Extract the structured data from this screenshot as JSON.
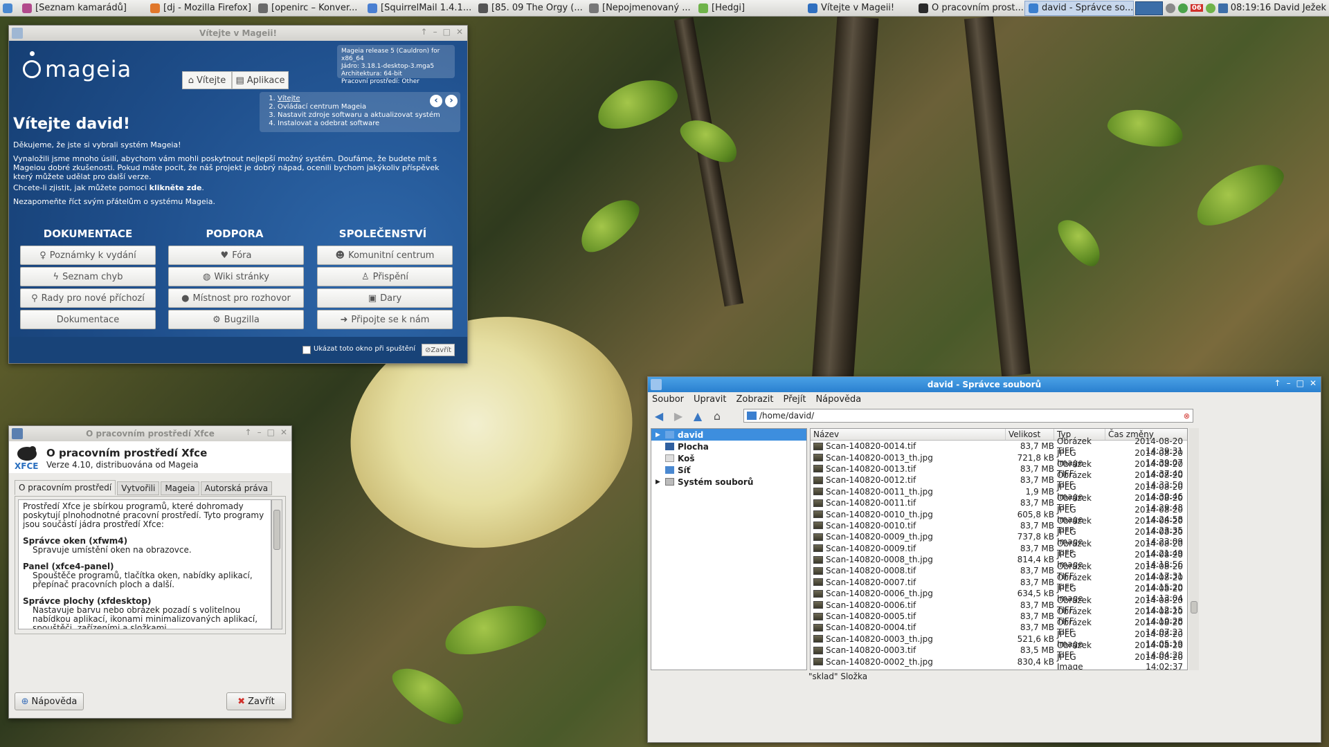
{
  "taskbar": {
    "tasks": [
      {
        "label": "[Seznam kamarádů]",
        "color": "#b24a8c"
      },
      {
        "label": "[dj - Mozilla Firefox]",
        "color": "#e0772a"
      },
      {
        "label": "[openirc – Konver...",
        "color": "#6a6a6a"
      },
      {
        "label": "[SquirrelMail 1.4.1...",
        "color": "#4a7fd1"
      },
      {
        "label": "[85. 09 The Orgy (...",
        "color": "#555555"
      },
      {
        "label": "[Nepojmenovaný ...",
        "color": "#777777"
      },
      {
        "label": "[Hedgi]",
        "color": "#6fb34a"
      },
      {
        "label": "Vítejte v Mageii!",
        "color": "#2f6fbf"
      },
      {
        "label": "O pracovním prost...",
        "color": "#2a2a2a"
      },
      {
        "label": "david - Správce so...",
        "color": "#3b7fcf"
      }
    ],
    "clock": "08:19:16",
    "user": "David Ježek",
    "badge": "06"
  },
  "mageia": {
    "title": "Vítejte v Mageii!",
    "logo": "mageia",
    "release": [
      "Mageia release 5 (Cauldron) for x86_64",
      "Jádro: 3.18.1-desktop-3.mga5",
      "Architektura: 64-bit",
      "Pracovní prostředí: Other"
    ],
    "nav": {
      "welcome": "Vítejte",
      "apps": "Aplikace"
    },
    "steps": [
      "Vítejte",
      "Ovládací centrum Mageia",
      "Nastavit zdroje softwaru a aktualizovat systém",
      "Instalovat a odebrat software"
    ],
    "heading": "Vítejte david!",
    "p1": "Děkujeme, že jste si vybrali systém Mageia!",
    "p2": "Vynaložili jsme mnoho úsilí, abychom vám mohli poskytnout nejlepší možný systém. Doufáme, že budete mít s Mageiou dobré zkušenosti. Pokud máte pocit, že náš projekt je dobrý nápad, ocenili bychom jakýkoliv příspěvek který můžete udělat pro další verze.",
    "p3a": "Chcete-li zjistit, jak můžete pomoci ",
    "p3b": "klikněte zde",
    "p3c": ".",
    "p4": "Nezapomeňte říct svým přátelům o systému Mageia.",
    "sections": {
      "docs": "DOKUMENTACE",
      "support": "PODPORA",
      "community": "SPOLEČENSTVÍ"
    },
    "docs_buttons": [
      "Poznámky k vydání",
      "Seznam chyb",
      "Rady pro nové příchozí",
      "Dokumentace"
    ],
    "support_buttons": [
      "Fóra",
      "Wiki stránky",
      "Místnost pro rozhovor",
      "Bugzilla"
    ],
    "community_buttons": [
      "Komunitní centrum",
      "Přispění",
      "Dary",
      "Připojte se k nám"
    ],
    "show_on_start": "Ukázat toto okno při spuštění",
    "close": "Zavřít"
  },
  "xfce": {
    "title": "O pracovním prostředí Xfce",
    "heading": "O pracovním prostředí Xfce",
    "version": "Verze 4.10, distribuována od Mageia",
    "tabs": [
      "O pracovním prostředí",
      "Vytvořili",
      "Mageia",
      "Autorská práva"
    ],
    "intro": "Prostředí Xfce je sbírkou programů, které dohromady poskytují plnohodnotné pracovní prostředí. Tyto programy jsou součástí jádra prostředí Xfce:",
    "items": [
      {
        "h": "Správce oken (xfwm4)",
        "d": "Spravuje umístění oken na obrazovce."
      },
      {
        "h": "Panel (xfce4-panel)",
        "d": "Spouštěče programů, tlačítka oken, nabídky aplikací, přepínač pracovních ploch a další."
      },
      {
        "h": "Správce plochy (xfdesktop)",
        "d": "Nastavuje barvu nebo obrázek pozadí s volitelnou nabídkou aplikací, ikonami minimalizovaných aplikací, spouštěči, zařízeními a složkami."
      }
    ],
    "help": "Nápověda",
    "close": "Zavřít"
  },
  "thunar": {
    "title": "david - Správce souborů",
    "menu": [
      "Soubor",
      "Upravit",
      "Zobrazit",
      "Přejít",
      "Nápověda"
    ],
    "location": "/home/david/",
    "sidebar": [
      "david",
      "Plocha",
      "Koš",
      "Síť",
      "Systém souborů"
    ],
    "columns": [
      "Název",
      "Velikost",
      "Typ",
      "Čas změny"
    ],
    "files": [
      [
        "Scan-140820-0014.tif",
        "83,7 MB",
        "Obrázek TIFF",
        "2014-08-20 14:39:31"
      ],
      [
        "Scan-140820-0013_th.jpg",
        "721,8 kB",
        "JPEG Image",
        "2014-08-20 14:39:07"
      ],
      [
        "Scan-140820-0013.tif",
        "83,7 MB",
        "Obrázek TIFF",
        "2014-08-20 14:37:40"
      ],
      [
        "Scan-140820-0012.tif",
        "83,7 MB",
        "Obrázek TIFF",
        "2014-08-20 14:33:50"
      ],
      [
        "Scan-140820-0011_th.jpg",
        "1,9 MB",
        "JPEG Image",
        "2014-08-20 14:30:46"
      ],
      [
        "Scan-140820-0011.tif",
        "83,7 MB",
        "Obrázek TIFF",
        "2014-08-20 14:29:48"
      ],
      [
        "Scan-140820-0010_th.jpg",
        "605,8 kB",
        "JPEG Image",
        "2014-08-20 14:24:58"
      ],
      [
        "Scan-140820-0010.tif",
        "83,7 MB",
        "Obrázek TIFF",
        "2014-08-20 14:23:35"
      ],
      [
        "Scan-140820-0009_th.jpg",
        "737,8 kB",
        "JPEG Image",
        "2014-08-20 14:23:09"
      ],
      [
        "Scan-140820-0009.tif",
        "83,7 MB",
        "Obrázek TIFF",
        "2014-08-20 14:21:49"
      ],
      [
        "Scan-140820-0008_th.jpg",
        "814,4 kB",
        "JPEG Image",
        "2014-08-20 14:18:56"
      ],
      [
        "Scan-140820-0008.tif",
        "83,7 MB",
        "Obrázek TIFF",
        "2014-08-20 14:17:31"
      ],
      [
        "Scan-140820-0007.tif",
        "83,7 MB",
        "Obrázek TIFF",
        "2014-08-20 14:15:20"
      ],
      [
        "Scan-140820-0006_th.jpg",
        "634,5 kB",
        "JPEG Image",
        "2014-08-20 14:13:04"
      ],
      [
        "Scan-140820-0006.tif",
        "83,7 MB",
        "Obrázek TIFF",
        "2014-08-20 14:12:15"
      ],
      [
        "Scan-140820-0005.tif",
        "83,7 MB",
        "Obrázek TIFF",
        "2014-08-20 14:10:28"
      ],
      [
        "Scan-140820-0004.tif",
        "83,7 MB",
        "Obrázek TIFF",
        "2014-08-20 14:07:23"
      ],
      [
        "Scan-140820-0003_th.jpg",
        "521,6 kB",
        "JPEG Image",
        "2014-08-20 14:05:19"
      ],
      [
        "Scan-140820-0003.tif",
        "83,5 MB",
        "Obrázek TIFF",
        "2014-08-20 14:04:28"
      ],
      [
        "Scan-140820-0002_th.jpg",
        "830,4 kB",
        "JPEG Image",
        "2014-08-20 14:02:37"
      ]
    ],
    "status": "\"sklad\" Složka"
  }
}
